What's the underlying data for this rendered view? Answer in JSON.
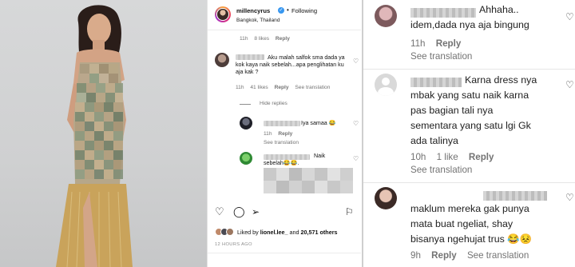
{
  "post": {
    "username": "millencyrus",
    "verified_glyph": "✓",
    "separator": "•",
    "follow_label": "Following",
    "location": "Bangkok, Thailand",
    "top_meta": {
      "time": "11h",
      "likes": "8 likes",
      "reply": "Reply"
    },
    "comment1": {
      "text": "Aku malah salfok sma dada ya kok kaya naik sebelah...apa penglihatan ku aja kak ?",
      "time": "11h",
      "likes": "41 likes",
      "reply": "Reply",
      "see_translation": "See translation"
    },
    "hide_replies": "Hide replies",
    "reply1": {
      "text": "Iya samaa 😂",
      "time": "11h",
      "reply": "Reply",
      "see_translation": "See translation"
    },
    "reply2": {
      "text": "Naik sebelah😂😂.",
      "time": "",
      "reply": ""
    },
    "likes_text_prefix": "Liked by",
    "likes_user": "lionel.lee_",
    "likes_and": "and",
    "likes_others": "20,571 others",
    "posted_time": "12 HOURS AGO"
  },
  "zoom": {
    "comment1": {
      "text_line1": "Ahhaha..",
      "text_line2": "idem,dada nya aja bingung",
      "time": "11h",
      "reply": "Reply",
      "see_translation": "See translation"
    },
    "comment2": {
      "line1": "Karna dress nya",
      "line2": "mbak yang satu naik karna",
      "line3": "pas bagian tali nya",
      "line4": "sementara yang satu lgi Gk",
      "line5": "ada talinya",
      "time": "10h",
      "likes": "1 like",
      "reply": "Reply",
      "see_translation": "See translation"
    },
    "comment3": {
      "line1": "maklum mereka gak punya",
      "line2": "mata buat ngeliat, shay",
      "line3": "bisanya ngehujat trus 😂😣",
      "time": "9h",
      "reply": "Reply",
      "see_translation": "See translation"
    }
  },
  "icons": [
    "heart-icon",
    "comment-icon",
    "share-icon",
    "bookmark-icon",
    "more-icon",
    "verified-icon"
  ],
  "colors": {
    "verified": "#3897f0",
    "meta_gray": "#737373",
    "dress_gold": "#c9a35b"
  }
}
